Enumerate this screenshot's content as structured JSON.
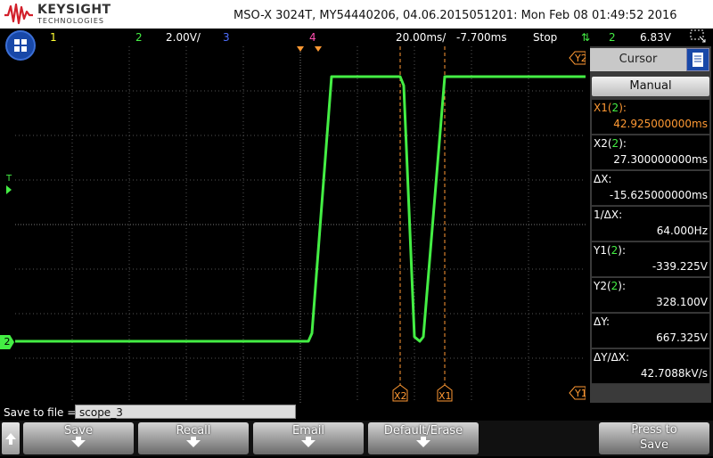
{
  "header": {
    "brand_name": "KEYSIGHT",
    "brand_sub": "TECHNOLOGIES",
    "instrument_info": "MSO-X 3024T, MY54440206, 04.06.2015051201: Mon Feb 08 01:49:52 2016"
  },
  "status": {
    "ch1": "1",
    "ch2": "2",
    "ch2_scale": "2.00V/",
    "ch3": "3",
    "ch4": "4",
    "timebase": "20.00ms/",
    "delay": "-7.700ms",
    "run_state": "Stop",
    "trigger_channel": "2",
    "trigger_level": "6.83V"
  },
  "colors": {
    "ch1": "#ffff33",
    "ch2": "#44ee44",
    "ch3": "#4f6fff",
    "ch4": "#ff4fb0",
    "cursor": "#ff9933",
    "panel_blue": "#1848a8"
  },
  "markers": {
    "y2": "Y2",
    "y1": "Y1",
    "x1": "X1",
    "x2": "X2",
    "trigger": "T",
    "ch2_ground": "2"
  },
  "cursor_panel": {
    "title": "Cursor",
    "mode": "Manual",
    "readouts": [
      {
        "label": "X1(",
        "ch": "2",
        "label_end": "):",
        "value": "42.925000000ms",
        "active": true
      },
      {
        "label": "X2(",
        "ch": "2",
        "label_end": "):",
        "value": "27.300000000ms",
        "active": false
      },
      {
        "label": "ΔX:",
        "ch": "",
        "label_end": "",
        "value": "-15.625000000ms",
        "active": false
      },
      {
        "label": "1/ΔX:",
        "ch": "",
        "label_end": "",
        "value": "64.000Hz",
        "active": false
      },
      {
        "label": "Y1(",
        "ch": "2",
        "label_end": "):",
        "value": "-339.225V",
        "active": false
      },
      {
        "label": "Y2(",
        "ch": "2",
        "label_end": "):",
        "value": "328.100V",
        "active": false
      },
      {
        "label": "ΔY:",
        "ch": "",
        "label_end": "",
        "value": "667.325V",
        "active": false
      },
      {
        "label": "ΔY/ΔX:",
        "ch": "",
        "label_end": "",
        "value": "42.7088kV/s",
        "active": false
      }
    ]
  },
  "save": {
    "label": "Save to file =",
    "filename": "scope_3"
  },
  "softkeys": {
    "save": "Save",
    "recall": "Recall",
    "email": "Email",
    "default_erase": "Default/Erase",
    "press_to": "Press to",
    "press_save": "Save"
  }
}
